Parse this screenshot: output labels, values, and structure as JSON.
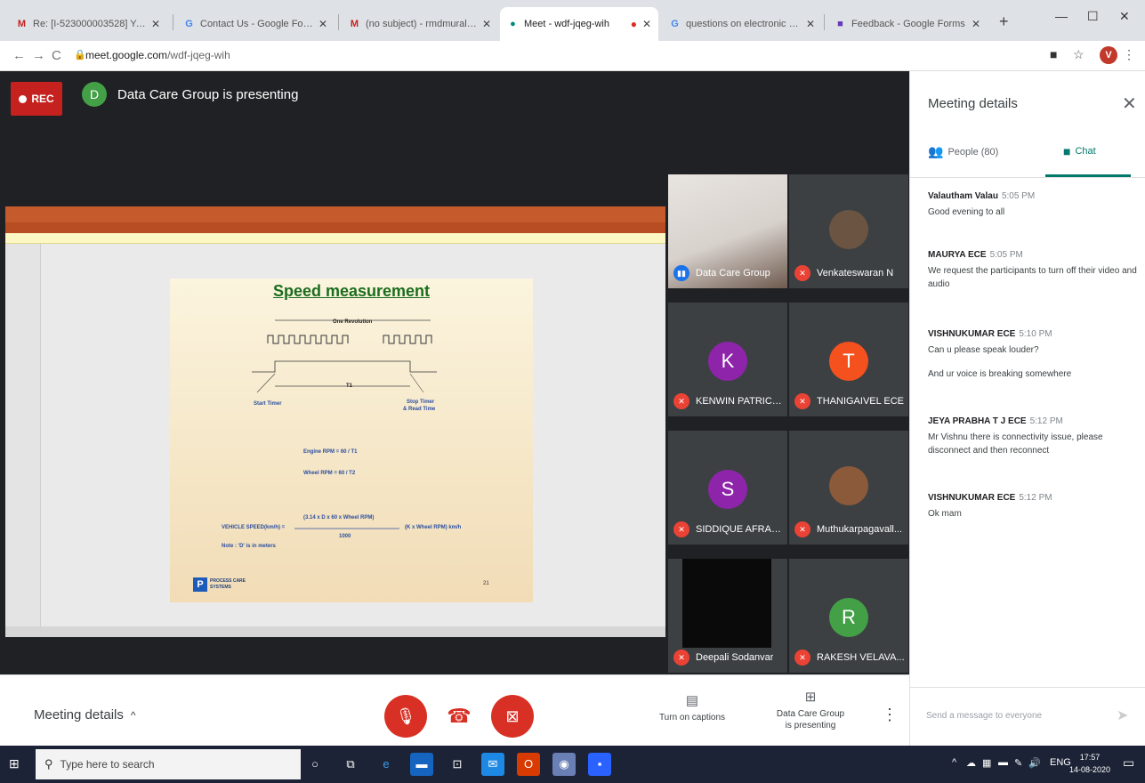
{
  "browser": {
    "tabs": [
      {
        "label": "Re: [I-523000003528] You",
        "icon": "M",
        "color": "#c5221f"
      },
      {
        "label": "Contact Us - Google For No",
        "icon": "G",
        "color": "#4285f4"
      },
      {
        "label": "(no subject) - rmdmuralidhar",
        "icon": "M",
        "color": "#c5221f"
      },
      {
        "label": "Meet - wdf-jqeg-wih",
        "icon": "●",
        "color": "#00897b"
      },
      {
        "label": "questions on electronic con",
        "icon": "G",
        "color": "#4285f4"
      },
      {
        "label": "Feedback - Google Forms",
        "icon": "■",
        "color": "#673ab7"
      }
    ],
    "new_tab": "+",
    "url_host": "meet.google.com",
    "url_path": "/wdf-jqeg-wih",
    "profile_initial": "V"
  },
  "stage": {
    "rec_label": "REC",
    "presenter_initial": "D",
    "presenter_text": "Data Care Group is presenting"
  },
  "slide": {
    "title": "Speed measurement",
    "one_revolution": "One Revolution",
    "t1": "T1",
    "start_timer": "Start Timer",
    "stop_timer_1": "Stop Timer",
    "stop_timer_2": "& Read Time",
    "engine_rpm": "Engine RPM = 60 / T1",
    "wheel_rpm": "Wheel RPM = 60 / T2",
    "vehicle_speed": "VEHICLE SPEED(km/h) =",
    "numerator": "(3.14 x D x 60 x Wheel RPM)",
    "denominator": "1000",
    "approx": "(K x Wheel RPM) km/h",
    "note": "Note : 'D' is in meters",
    "logo_text_1": "PROCESS CARE",
    "logo_text_2": "SYSTEMS",
    "page_number": "21"
  },
  "participants": [
    {
      "name": "Data Care Group",
      "type": "video"
    },
    {
      "name": "Venkateswaran N",
      "type": "photo"
    },
    {
      "name": "KENWIN PATRICK...",
      "initial": "K",
      "color": "#8e24aa"
    },
    {
      "name": "THANIGAIVEL ECE",
      "initial": "T",
      "color": "#f4511e"
    },
    {
      "name": "SIDDIQUE AFRAA...",
      "initial": "S",
      "color": "#8e24aa"
    },
    {
      "name": "Muthukarpagavall...",
      "type": "photo"
    },
    {
      "name": "Deepali Sodanvar",
      "type": "dark"
    },
    {
      "name": "RAKESH VELAVA...",
      "initial": "R",
      "color": "#43a047"
    }
  ],
  "panel": {
    "title": "Meeting details",
    "people_tab": "People (80)",
    "chat_tab": "Chat",
    "messages": [
      {
        "sender": "Valautham Valau",
        "time": "5:05 PM",
        "text": "Good evening to all"
      },
      {
        "sender": "MAURYA ECE",
        "time": "5:05 PM",
        "text": "We request the participants to turn off their video and audio"
      },
      {
        "sender": "VISHNUKUMAR ECE",
        "time": "5:10 PM",
        "text": "Can u please speak louder?",
        "text2": "And ur voice is breaking somewhere"
      },
      {
        "sender": "JEYA PRABHA T J ECE",
        "time": "5:12 PM",
        "text": "Mr Vishnu there is connectivity issue, please disconnect and then reconnect"
      },
      {
        "sender": "VISHNUKUMAR ECE",
        "time": "5:12 PM",
        "text": "Ok mam"
      }
    ],
    "send_placeholder": "Send a message to everyone"
  },
  "controls": {
    "meeting_details": "Meeting details",
    "captions": "Turn on captions",
    "presenting_1": "Data Care Group",
    "presenting_2": "is presenting"
  },
  "taskbar": {
    "search_placeholder": "Type here to search",
    "time": "17:57",
    "date": "14-08-2020"
  }
}
